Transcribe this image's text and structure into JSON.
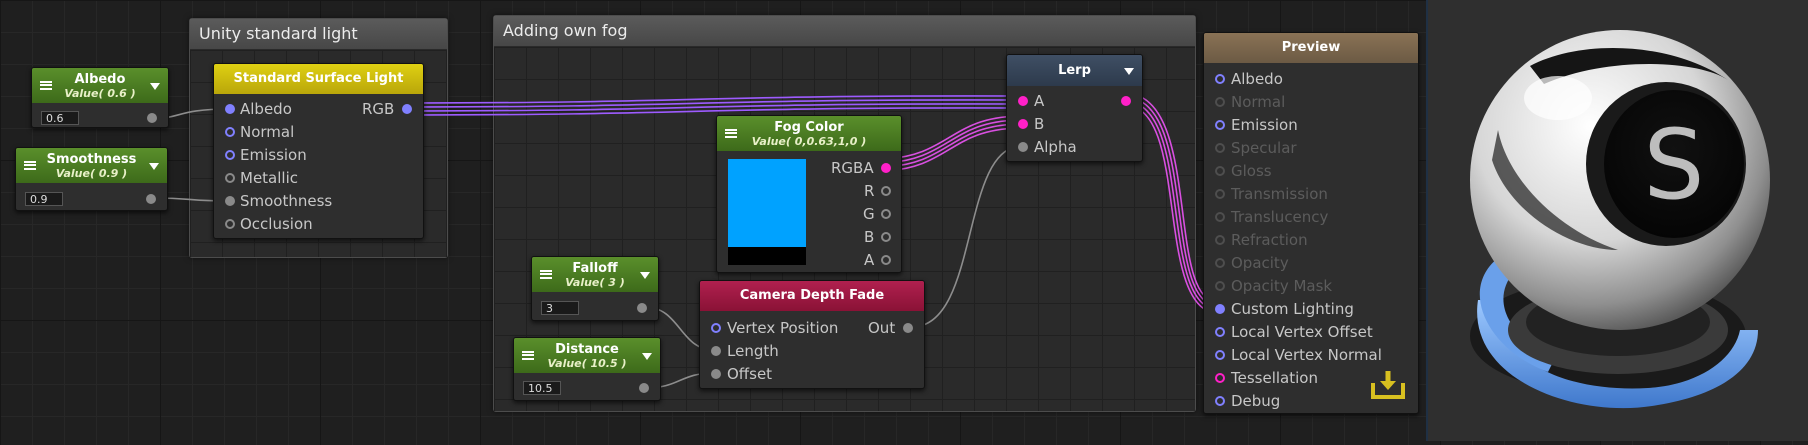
{
  "groups": {
    "unity": {
      "title": "Unity standard light"
    },
    "fog": {
      "title": "Adding own fog"
    }
  },
  "albedo_node": {
    "title": "Albedo",
    "subtitle": "Value( 0.6 )",
    "value": "0.6"
  },
  "smoothness_node": {
    "title": "Smoothness",
    "subtitle": "Value( 0.9 )",
    "value": "0.9"
  },
  "standard_surface_light": {
    "title": "Standard Surface Light",
    "inputs": [
      "Albedo",
      "Normal",
      "Emission",
      "Metallic",
      "Smoothness",
      "Occlusion"
    ],
    "output": "RGB"
  },
  "fog_color": {
    "title": "Fog Color",
    "subtitle": "Value( 0,0.63,1,0 )",
    "swatch_color": "#00a2ff",
    "outputs": [
      "RGBA",
      "R",
      "G",
      "B",
      "A"
    ]
  },
  "falloff_node": {
    "title": "Falloff",
    "subtitle": "Value( 3 )",
    "value": "3"
  },
  "distance_node": {
    "title": "Distance",
    "subtitle": "Value( 10.5 )",
    "value": "10.5"
  },
  "camera_depth_fade": {
    "title": "Camera Depth Fade",
    "inputs": [
      "Vertex Position",
      "Length",
      "Offset"
    ],
    "output": "Out"
  },
  "lerp": {
    "title": "Lerp",
    "inputs": [
      "A",
      "B",
      "Alpha"
    ]
  },
  "preview": {
    "title": "Preview",
    "inputs": [
      "Albedo",
      "Normal",
      "Emission",
      "Specular",
      "Gloss",
      "Transmission",
      "Translucency",
      "Refraction",
      "Opacity",
      "Opacity Mask",
      "Custom Lighting",
      "Local Vertex Offset",
      "Local Vertex Normal",
      "Tessellation",
      "Debug"
    ],
    "logo_letter": "S"
  },
  "colors": {
    "wire_purple": "#a050ff",
    "wire_magenta": "#e040d0",
    "header_green": "#4a7d22",
    "header_yellow": "#d4c210",
    "header_red": "#a0183f",
    "accent_yellow": "#e0c020"
  }
}
